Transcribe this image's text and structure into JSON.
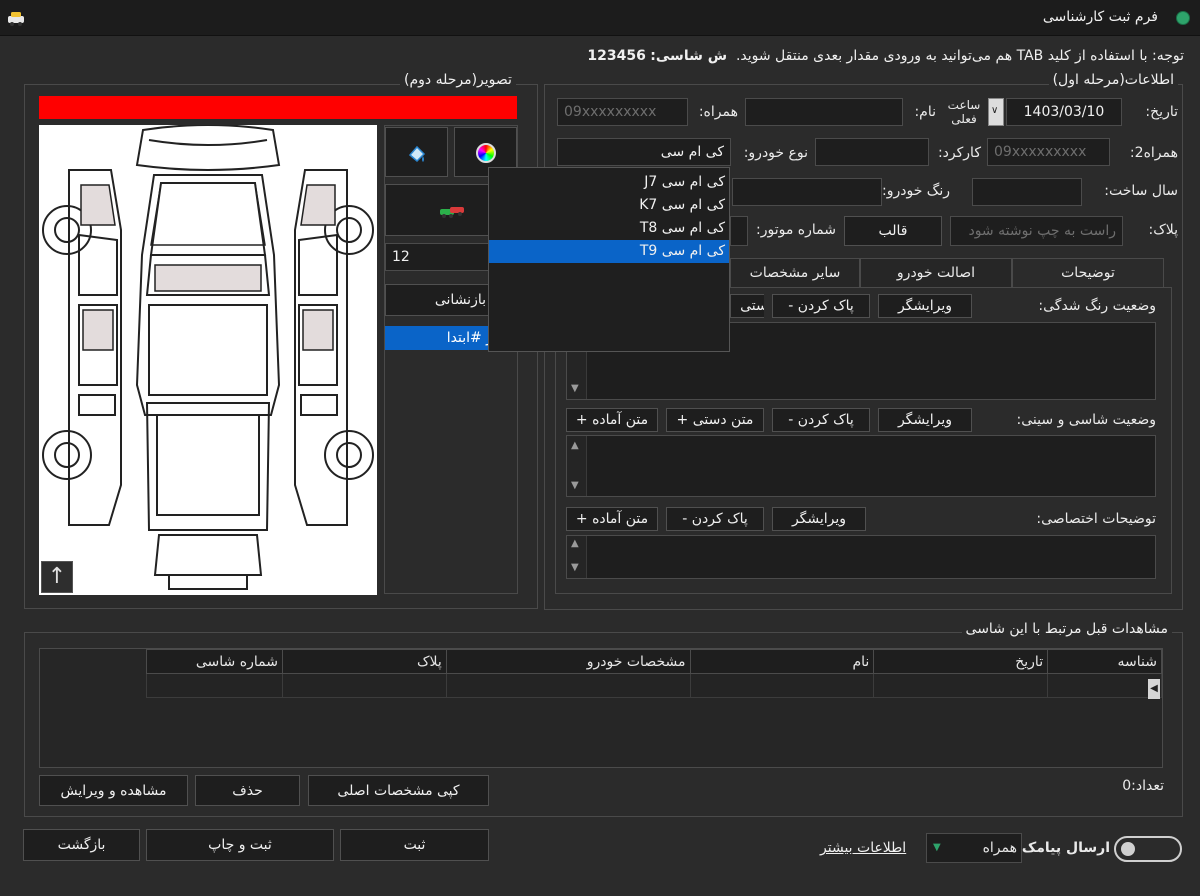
{
  "window": {
    "title": "فرم ثبت کارشناسی"
  },
  "notice": {
    "text": "توجه: با استفاده از کلید TAB هم می‌توانید به ورودی مقدار بعدی منتقل شوید.",
    "chassis_label": "ش شاسی:",
    "chassis_value": "123456"
  },
  "stage1": {
    "title": "اطلاعات(مرحله اول)",
    "date_label": "تاریخ:",
    "date_value": "1403/03/10",
    "current_time_label": "ساعت فعلی",
    "name_label": "نام:",
    "name_value": "",
    "mobile_label": "همراه:",
    "mobile_placeholder": "09xxxxxxxxx",
    "mobile2_label": "همراه2:",
    "mobile2_placeholder": "09xxxxxxxxx",
    "mileage_label": "کارکرد:",
    "mileage_value": "",
    "car_type_label": "نوع خودرو:",
    "car_type_value": "کی ام سی",
    "year_label": "سال ساخت:",
    "year_value": "",
    "color_label": "رنگ خودرو:",
    "color_value": "",
    "plate_label": "پلاک:",
    "plate_placeholder": "راست به چپ نوشته شود",
    "template_button": "قالب",
    "engine_label": "شماره موتور:"
  },
  "car_type_dropdown": {
    "options": [
      "کی ام سی J7",
      "کی ام سی K7",
      "کی ام سی T8",
      "کی ام سی T9"
    ],
    "selected_index": 3
  },
  "tabs": [
    {
      "label": "توضیحات",
      "active": true
    },
    {
      "label": "اصالت خودرو",
      "active": false
    },
    {
      "label": "سایر مشخصات",
      "active": false
    }
  ],
  "sections": [
    {
      "label": "وضعیت رنگ شدگی:",
      "editor": "ویرایشگر",
      "clear": "- پاک کردن",
      "manual": "+ متن دستی"
    },
    {
      "label": "وضعیت شاسی و سینی:",
      "editor": "ویرایشگر",
      "clear": "- پاک کردن",
      "manual": "+ متن دستی",
      "ready": "+ متن آماده"
    },
    {
      "label": "توضیحات اختصاصی:",
      "editor": "ویرایشگر",
      "clear": "- پاک کردن",
      "ready": "+ متن آماده"
    }
  ],
  "stage2": {
    "title": "تصویر(مرحله دوم)",
    "counter_value": "12",
    "reset_button": "بازنشانی",
    "list_item": "تغییر #ابتدا",
    "colors": {
      "red_bar": "#ff0000",
      "selection": "#0a64c8"
    }
  },
  "history": {
    "title": "مشاهدات قبل مرتبط با این شاسی",
    "columns": [
      "شناسه",
      "تاریخ",
      "نام",
      "مشخصات خودرو",
      "پلاک",
      "شماره شاسی"
    ],
    "count_label": "تعداد:",
    "count_value": "0",
    "copy_button": "کپی مشخصات اصلی",
    "delete_button": "حذف",
    "view_edit_button": "مشاهده و ویرایش"
  },
  "footer": {
    "sms_label": "ارسال پیامک",
    "sms_target": "همراه",
    "more_info": "اطلاعات بیشتر",
    "save_button": "ثبت",
    "save_print_button": "ثبت و چاپ",
    "back_button": "بازگشت"
  }
}
